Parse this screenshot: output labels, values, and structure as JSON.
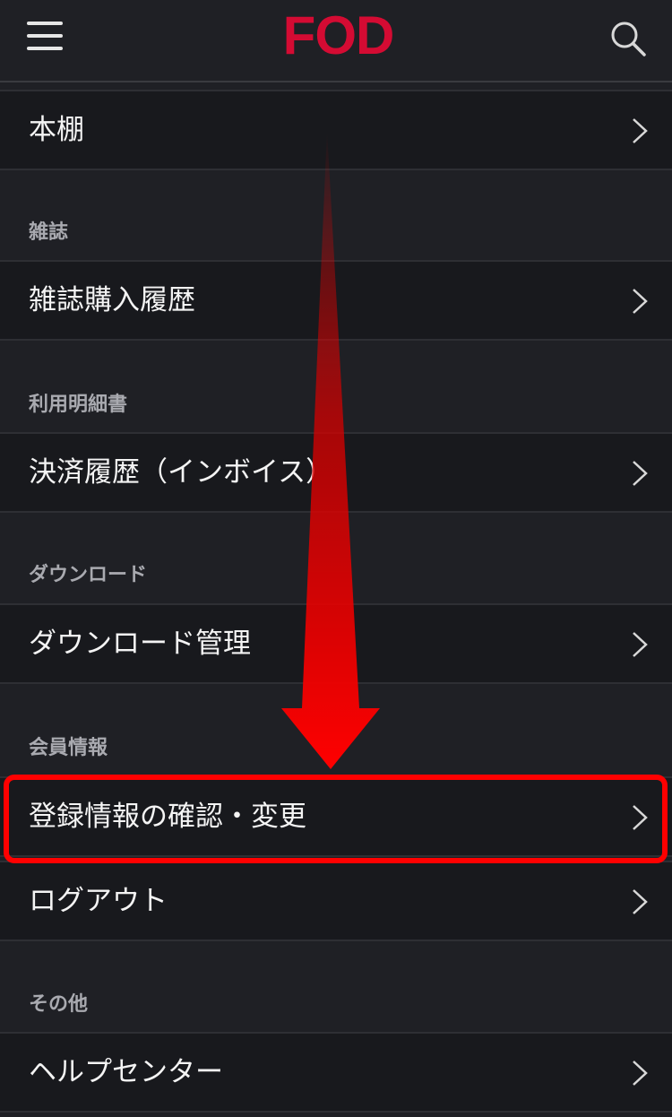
{
  "header": {
    "logo_text": "FOD",
    "brand_color": "#d40b33",
    "menu_icon": "hamburger-menu-icon",
    "search_icon": "search-icon"
  },
  "rows": {
    "bookshelf": "本棚",
    "magazine_history": "雑誌購入履歴",
    "payment_history": "決済履歴（インボイス）",
    "download_management": "ダウンロード管理",
    "registration_info": "登録情報の確認・変更",
    "logout": "ログアウト",
    "help_center": "ヘルプセンター"
  },
  "sections": {
    "magazine": "雑誌",
    "statement": "利用明細書",
    "download": "ダウンロード",
    "member_info": "会員情報",
    "other": "その他"
  },
  "annotation": {
    "color": "#ff0000",
    "arrow_icon": "down-arrow-annotation",
    "highlight": "registration_info"
  }
}
